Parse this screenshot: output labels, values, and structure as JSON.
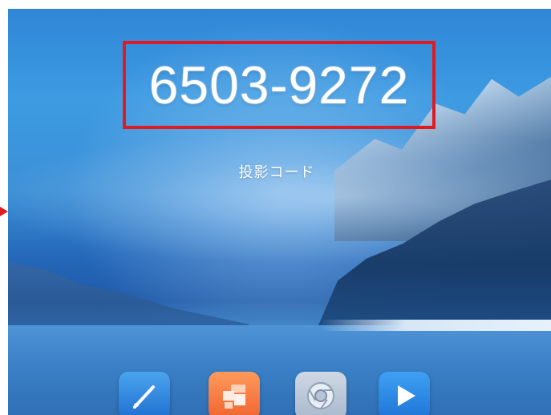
{
  "projection": {
    "code": "6503-9272",
    "label": "投影コード",
    "highlight_color": "#e11a22"
  },
  "dock": {
    "apps": [
      {
        "icon": "pen-icon",
        "color": "#1f6fd0"
      },
      {
        "icon": "grid-tiles-icon",
        "color": "#f0632f"
      },
      {
        "icon": "browser-icon",
        "color": "#a9b8cc"
      },
      {
        "icon": "play-icon",
        "color": "#1d74d6"
      }
    ]
  }
}
